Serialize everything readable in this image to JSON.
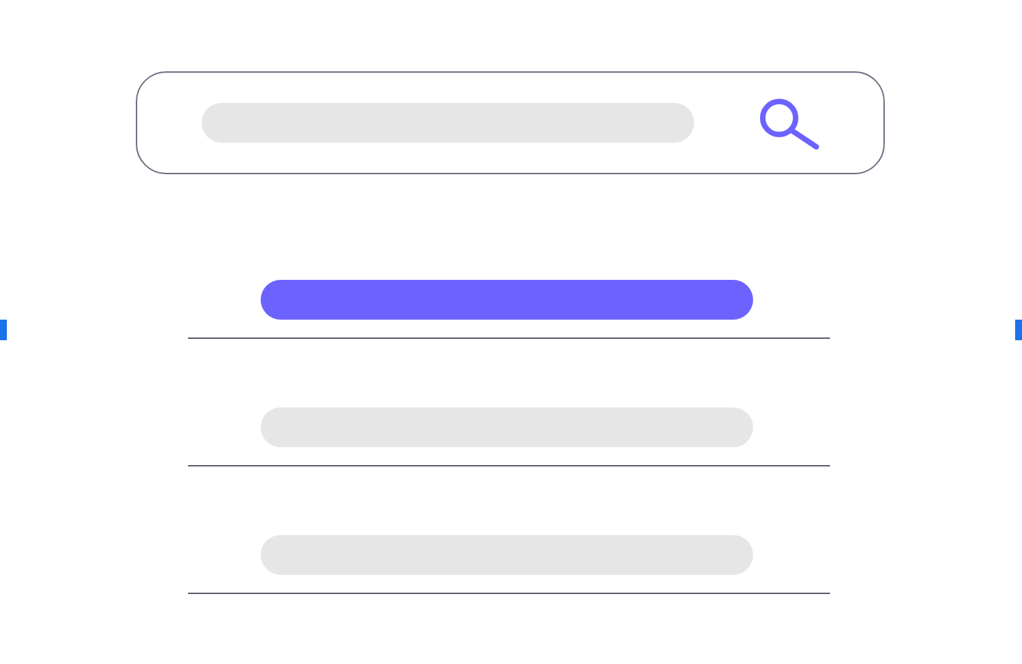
{
  "results": [
    {
      "selected": true
    },
    {
      "selected": false
    },
    {
      "selected": false
    }
  ]
}
